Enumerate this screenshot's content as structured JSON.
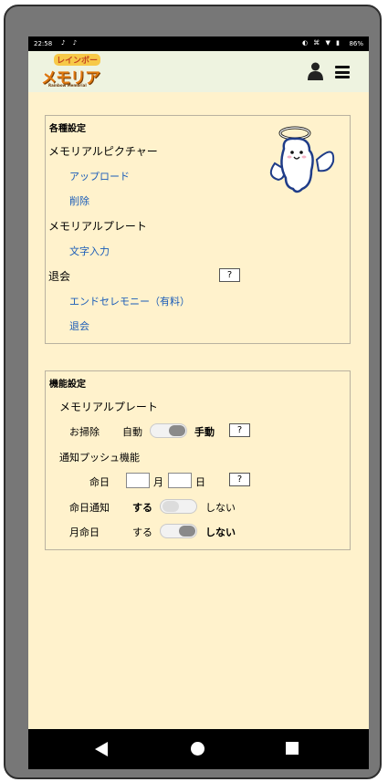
{
  "status_bar": {
    "time": "22:58",
    "left_icons": "♪ ♪",
    "right_icons": "◐ ⌘ ▼ ▮",
    "battery": "86%"
  },
  "header": {
    "logo_top": "レインボー",
    "logo_title": "メモリアル",
    "logo_sub": "Rainbow Memorial",
    "icons": [
      "user-icon",
      "menu-icon"
    ]
  },
  "settings": {
    "title": "各種設定",
    "memorial_picture": {
      "label": "メモリアルピクチャー",
      "upload": "アップロード",
      "delete": "削除"
    },
    "memorial_plate": {
      "label": "メモリアルプレート",
      "text_input": "文字入力"
    },
    "withdrawal": {
      "label": "退会",
      "help": "?",
      "end_ceremony": "エンドセレモニー（有料）",
      "withdraw": "退会"
    }
  },
  "features": {
    "title": "機能設定",
    "memorial_plate_label": "メモリアルプレート",
    "cleaning": {
      "label": "お掃除",
      "option_auto": "自動",
      "option_manual": "手動",
      "selected": "手動",
      "help": "?"
    },
    "push": {
      "label": "通知プッシュ機能",
      "death_date_label": "命日",
      "month_unit": "月",
      "day_unit": "日",
      "month_value": "",
      "day_value": "",
      "help": "?"
    },
    "death_date_notice": {
      "label": "命日通知",
      "option_on": "する",
      "option_off": "しない",
      "selected": "する"
    },
    "monthly_death_date": {
      "label": "月命日",
      "option_on": "する",
      "option_off": "しない",
      "selected": "しない"
    }
  },
  "navbar": {
    "icons": [
      "back-icon",
      "home-icon",
      "recent-apps-icon"
    ]
  },
  "colors": {
    "content_bg": "#fff2cc",
    "header_bg": "#eef3e0",
    "link": "#1a5cb8"
  }
}
